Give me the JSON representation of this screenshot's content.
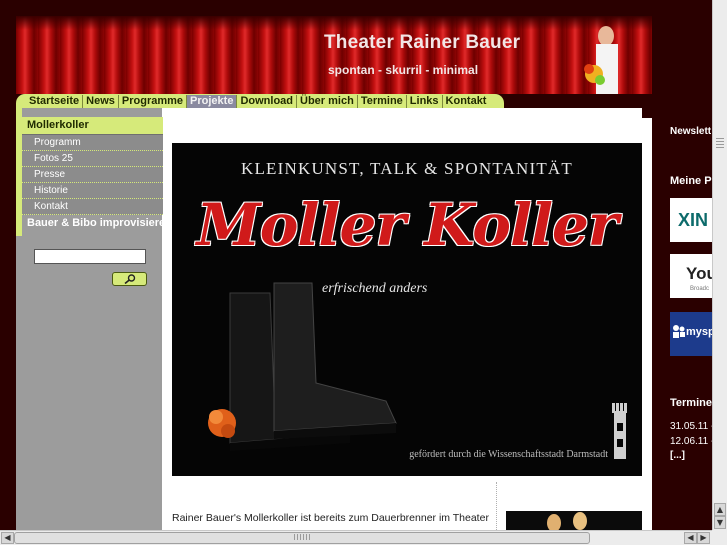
{
  "header": {
    "title": "Theater Rainer Bauer",
    "subtitle": "spontan - skurril - minimal"
  },
  "nav": {
    "items": [
      "Startseite",
      "News",
      "Programme",
      "Projekte",
      "Download",
      "Über mich",
      "Termine",
      "Links",
      "Kontakt"
    ],
    "active": "Projekte"
  },
  "sidebar": {
    "section_title": "Mollerkoller",
    "sub_items": [
      "Programm",
      "Fotos 25",
      "Presse",
      "Historie",
      "Kontakt"
    ],
    "second_section": "Bauer & Bibo improvisieren",
    "search_value": ""
  },
  "promo": {
    "tagline": "KLEINKUNST, TALK & SPONTANITÄT",
    "logo": "Moller Koller",
    "slogan": "erfrischend anders",
    "sponsor": "gefördert durch die Wissenschaftsstadt Darmstadt"
  },
  "intro_text": "Rainer Bauer's Mollerkoller ist bereits zum Dauerbrenner im Theater",
  "right_column": {
    "newsletter_heading": "Newslett",
    "profiles_heading": "Meine P",
    "badges": [
      "XIN",
      "You",
      "mysp"
    ],
    "badge_sub": "Broadc",
    "termine_heading": "Termine",
    "dates": [
      "31.05.11 -",
      "12.06.11 -"
    ],
    "more_link": "[...]"
  },
  "colors": {
    "nav_green": "#d6ea7a",
    "active_tab": "#8a8aa0",
    "curtain_red": "#c21010",
    "page_bg": "#2a0000"
  }
}
